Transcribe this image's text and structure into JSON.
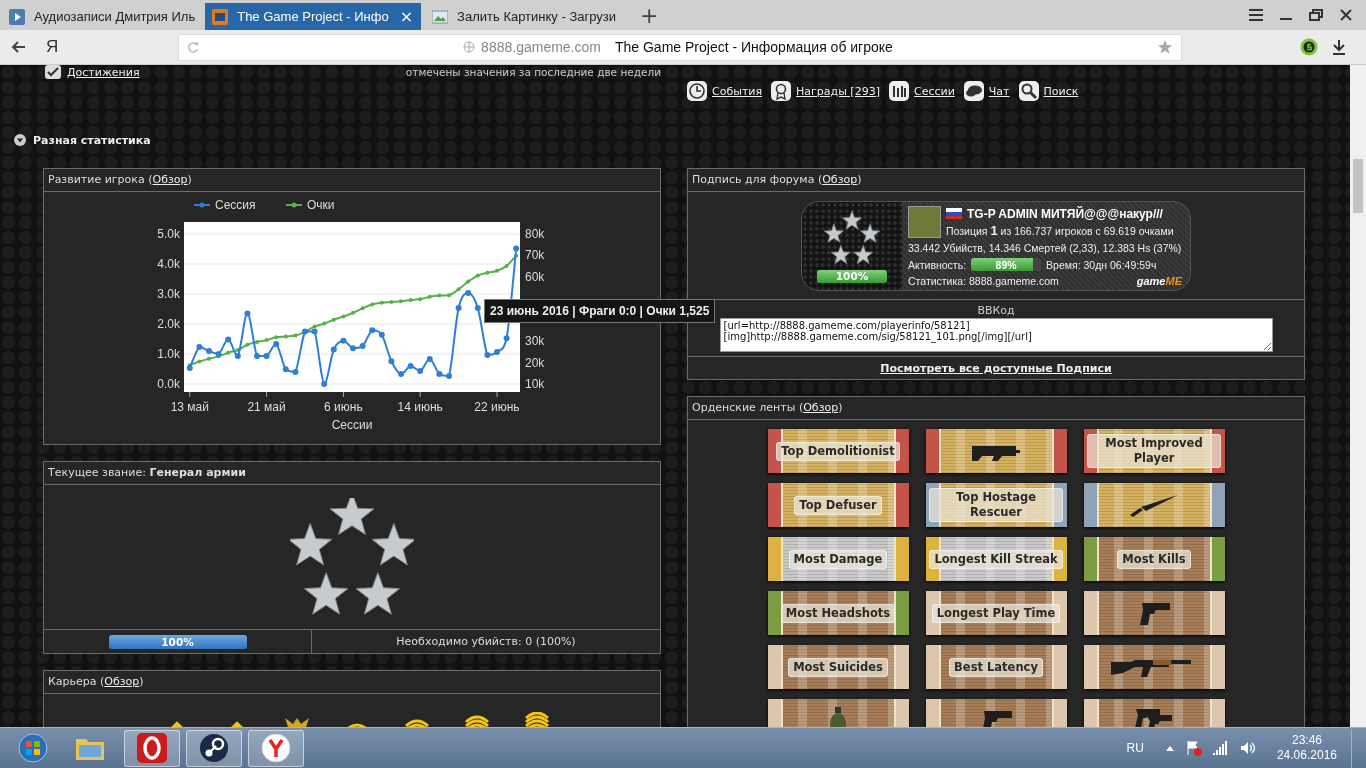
{
  "browser": {
    "tabs": [
      {
        "title": "Аудиозаписи Дмитрия Иль",
        "kind": "audio",
        "selected": false
      },
      {
        "title": "The Game Project - Инфо",
        "kind": "game",
        "selected": true,
        "close": "×"
      },
      {
        "title": "Залить Картинку - Загрузи",
        "kind": "image",
        "selected": false
      }
    ],
    "new_tab": "+",
    "logo": "Я",
    "address": {
      "domain": "8888.gameme.com",
      "title": "The Game Project - Информация об игроке"
    }
  },
  "page": {
    "achievements_link": "Достижения",
    "top_note": "отмечены значения за последние две недели",
    "nav": [
      {
        "label": "События",
        "kind": "clock"
      },
      {
        "label": "Награды [293]",
        "kind": "medal"
      },
      {
        "label": "Сессии",
        "kind": "bars"
      },
      {
        "label": "Чат",
        "kind": "chat"
      },
      {
        "label": "Поиск",
        "kind": "search"
      }
    ],
    "section": {
      "title": "Разная статистика",
      "expanded": true
    },
    "progress_panel": {
      "title": "Развитие игрока (",
      "link": "Обзор",
      "title_end": ")",
      "tooltip": "23 июнь 2016 | Фраги 0:0 | Очки 1,525",
      "chart_data": {
        "type": "line",
        "xlabel": "Сессии",
        "grid": true,
        "legend": "top",
        "categories": [
          "13 май",
          null,
          null,
          null,
          null,
          null,
          null,
          null,
          "21 май",
          null,
          null,
          null,
          null,
          null,
          null,
          null,
          "6 июнь",
          null,
          null,
          null,
          null,
          null,
          null,
          null,
          "14 июнь",
          null,
          null,
          null,
          null,
          null,
          null,
          null,
          "22 июнь",
          null,
          null
        ],
        "ylim": [
          0,
          5000
        ],
        "yticks": [
          {
            "value": 0,
            "label": "0.0k"
          },
          {
            "value": 1000,
            "label": "1.0k"
          },
          {
            "value": 2000,
            "label": "2.0k"
          },
          {
            "value": 3000,
            "label": "3.0k"
          },
          {
            "value": 4000,
            "label": "4.0k"
          },
          {
            "value": 5000,
            "label": "5.0k"
          }
        ],
        "y2lim": [
          10000,
          80000
        ],
        "y2ticks": [
          {
            "value": 10000,
            "label": "10k"
          },
          {
            "value": 20000,
            "label": "20k"
          },
          {
            "value": 30000,
            "label": "30k"
          },
          {
            "value": 60000,
            "label": "60k"
          },
          {
            "value": 70000,
            "label": "70k"
          },
          {
            "value": 80000,
            "label": "80k"
          }
        ],
        "series": [
          {
            "name": "Сессия",
            "color": "#2f7ed8",
            "marker": true,
            "values": [
              530,
              1230,
              1100,
              1000,
              1480,
              930,
              2350,
              930,
              930,
              1330,
              490,
              400,
              1750,
              1750,
              0,
              1150,
              1440,
              1190,
              1270,
              1790,
              1640,
              760,
              330,
              600,
              430,
              830,
              330,
              270,
              2530,
              3030,
              2530,
              970,
              1070,
              1525,
              4520
            ]
          },
          {
            "name": "Очки",
            "color": "#55b04a",
            "axis": "y2",
            "marker": true,
            "values": [
              18800,
              20500,
              21800,
              22900,
              24600,
              25900,
              28300,
              29600,
              30500,
              31800,
              32200,
              32600,
              34300,
              36800,
              38200,
              40000,
              41500,
              43200,
              45300,
              47100,
              47900,
              48300,
              48600,
              49200,
              49600,
              50700,
              51300,
              51400,
              54200,
              57800,
              60600,
              61900,
              62800,
              65100,
              69900
            ]
          }
        ]
      }
    },
    "rank_panel": {
      "title": "Текущее звание: **Генерал армии**",
      "level": 1,
      "progress_label": "100%",
      "kills_needed": "Необходимо убийств: 0 (100%)"
    },
    "career_panel": {
      "title": "Карьера (",
      "link": "Обзор",
      "title_end": ")",
      "insignia": [
        {
          "kind": "chevron"
        },
        {
          "kind": "chevron"
        },
        {
          "kind": "eagle"
        },
        {
          "kind": "arc1"
        },
        {
          "kind": "arc2"
        },
        {
          "kind": "arc3"
        },
        {
          "kind": "arc4"
        }
      ]
    },
    "signature_panel": {
      "title": "Подпись для форума (",
      "link": "Обзор",
      "title_end": ")",
      "card": {
        "name": "TG-P ADMIN МИТЯЙ@@@накур///",
        "position": "Позиция **1** из 166.737 игроков с 69.619 очками",
        "stats": "33.442 Убийств, 14.346 Смертей (2,33), 12.383 Hs (37%)",
        "activity_label": "Активность:",
        "activity": {
          "level": 0.89,
          "label": "89%"
        },
        "time": "Время: 30дн 06:49:59ч",
        "site": "Статистика: 8888.gameme.com",
        "rank_progress": {
          "level": 1,
          "label": "100%"
        },
        "logo": [
          "game",
          "ME"
        ]
      },
      "bbcode_label": "BBКод",
      "bbcode": "[url=http://8888.gameme.com/playerinfo/58121]\n[img]http://8888.gameme.com/sig/58121_101.png[/img][/url]",
      "all_link": "Посмотреть все доступные Подписи"
    },
    "ribbons_panel": {
      "title": "Орденские ленты (",
      "link": "Обзор",
      "title_end": ")",
      "ribbons": [
        {
          "kind": "text",
          "label": "Top Demolitionist",
          "color": "#c4534a",
          "body": {
            "color": "#d6b15e"
          }
        },
        {
          "kind": "smg",
          "color": "#c4534a",
          "body": {
            "color": "#d6b15e"
          }
        },
        {
          "kind": "text",
          "label": "Most Improved Player",
          "color": "#c4534a",
          "body": {
            "color": "#d6b15e"
          }
        },
        {
          "kind": "text",
          "label": "Top Defuser",
          "color": "#c4534a",
          "body": {
            "color": "#d6b15e"
          }
        },
        {
          "kind": "text",
          "label": "Top Hostage Rescuer",
          "color": "#8fa2b6",
          "body": {
            "color": "#d6b15e"
          }
        },
        {
          "kind": "knife",
          "color": "#8fa2b6",
          "body": {
            "color": "#d6b15e"
          }
        },
        {
          "kind": "text",
          "label": "Most Damage",
          "color": "#ddb23e",
          "body": {
            "color": "#c9c9c9"
          }
        },
        {
          "kind": "text",
          "label": "Longest Kill Streak",
          "color": "#ddb23e",
          "body": {
            "color": "#c9c9c9"
          }
        },
        {
          "kind": "text",
          "label": "Most Kills",
          "color": "#7c9c44",
          "body": {
            "color": "#a77d57"
          }
        },
        {
          "kind": "text",
          "label": "Most Headshots",
          "color": "#7c9c44",
          "body": {
            "color": "#a77d57"
          }
        },
        {
          "kind": "text",
          "label": "Longest Play Time",
          "color": "#dcc6ae",
          "body": {
            "color": "#a77d57"
          }
        },
        {
          "kind": "pistol",
          "color": "#dcc6ae",
          "body": {
            "color": "#a77d57"
          }
        },
        {
          "kind": "text",
          "label": "Most Suicides",
          "color": "#dcc6ae",
          "body": {
            "color": "#a77d57"
          }
        },
        {
          "kind": "text",
          "label": "Best Latency",
          "color": "#dcc6ae",
          "body": {
            "color": "#a77d57"
          }
        },
        {
          "kind": "rifle",
          "color": "#dcc6ae",
          "body": {
            "color": "#a77d57"
          }
        },
        {
          "kind": "grenade",
          "color": "#dcc6ae",
          "body": {
            "color": "#a77d57"
          }
        },
        {
          "kind": "pistol",
          "color": "#dcc6ae",
          "body": {
            "color": "#a77d57"
          }
        },
        {
          "kind": "pistols",
          "color": "#dcc6ae",
          "body": {
            "color": "#a77d57"
          }
        }
      ]
    }
  },
  "taskbar": {
    "apps": [
      {
        "kind": "folder",
        "running": false
      },
      {
        "kind": "opera",
        "running": true
      },
      {
        "kind": "steam",
        "running": true
      },
      {
        "kind": "yandex",
        "running": true
      }
    ],
    "language": "RU",
    "time": "23:46",
    "date": "24.06.2016"
  }
}
